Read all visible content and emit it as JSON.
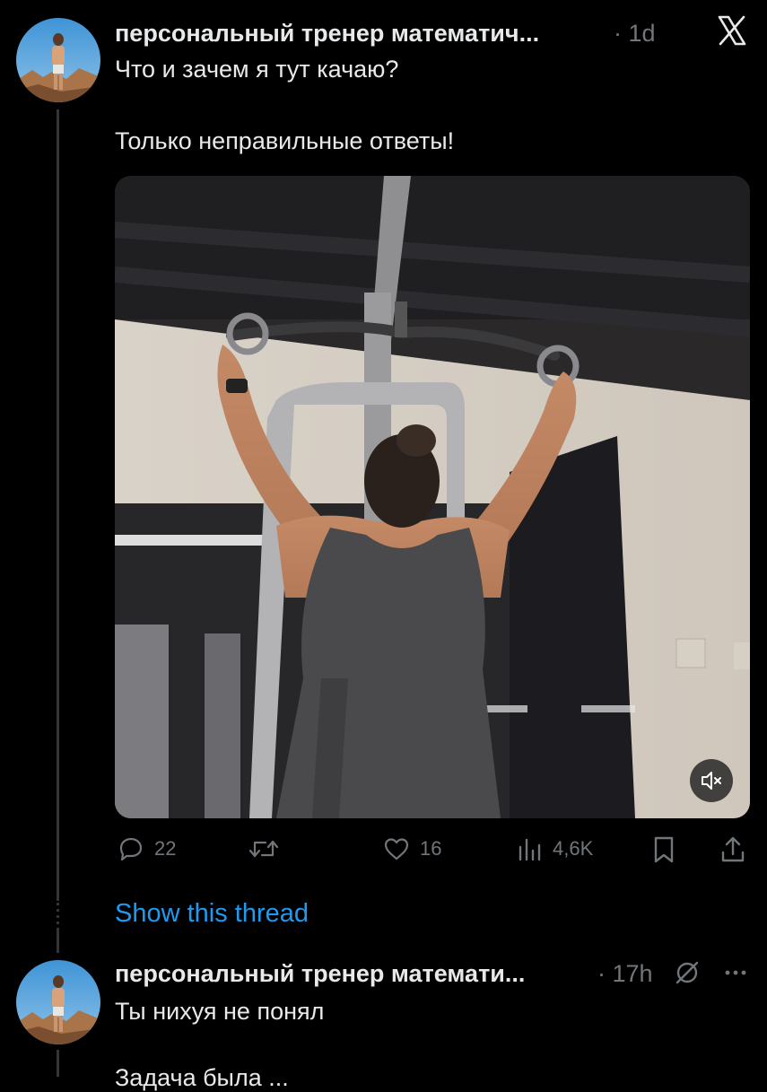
{
  "tweet": {
    "author": "персональный тренер математич...",
    "time": "· 1d",
    "line1": "Что и зачем я тут качаю?",
    "line2": "Только неправильные ответы!",
    "actions": {
      "replies": "22",
      "likes": "16",
      "views": "4,6K"
    }
  },
  "show_thread": "Show this thread",
  "reply": {
    "author": "персональный тренер математи...",
    "time": "· 17h",
    "line1": "Ты нихуя не понял",
    "line2": "Задача была ..."
  },
  "icons": {
    "close": "x-close-icon",
    "reply": "reply-icon",
    "retweet": "retweet-icon",
    "like": "heart-icon",
    "views": "views-icon",
    "bookmark": "bookmark-icon",
    "share": "share-icon",
    "mute": "speaker-muted-icon",
    "grok": "grok-icon",
    "more": "more-icon"
  },
  "colors": {
    "accent": "#1d9bf0",
    "muted": "#71767b",
    "text": "#e7e9ea",
    "background": "#000000"
  }
}
